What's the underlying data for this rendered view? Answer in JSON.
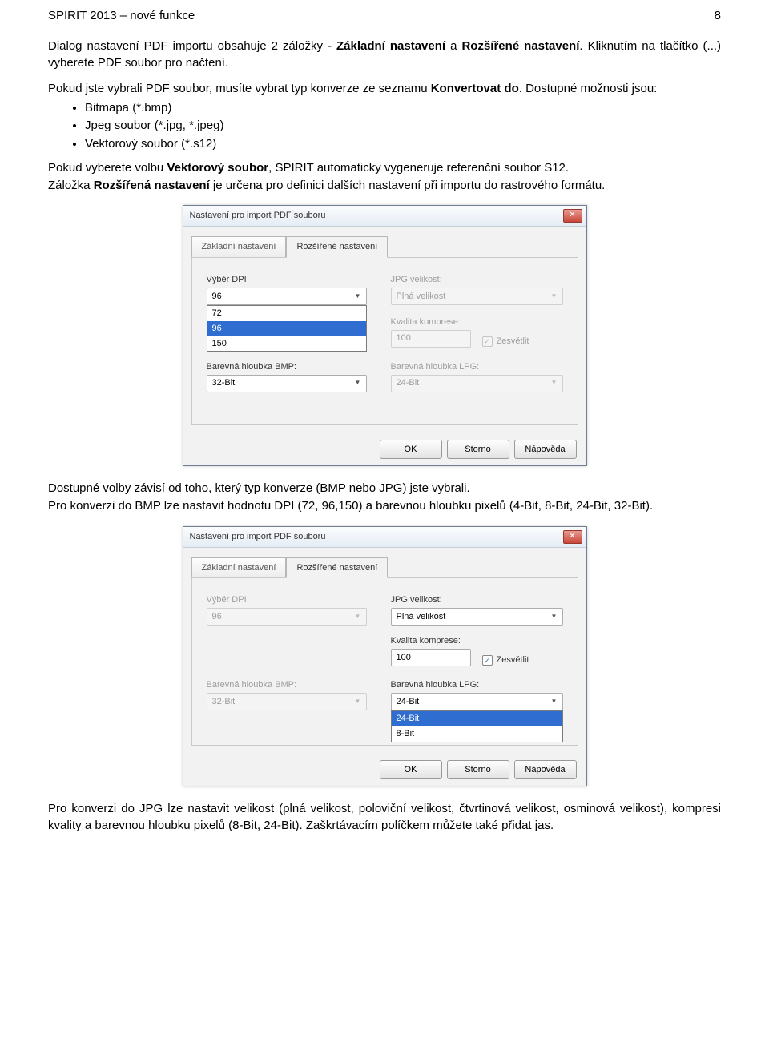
{
  "header": {
    "left": "SPIRIT 2013 – nové funkce",
    "right": "8"
  },
  "p1_a": "Dialog nastavení PDF importu obsahuje 2 záložky - ",
  "p1_b": "Základní nastavení",
  "p1_c": " a ",
  "p1_d": "Rozšířené nastavení",
  "p1_e": ". Kliknutím na tlačítko (...) vyberete PDF soubor pro načtení.",
  "p2_a": "Pokud jste vybrali PDF soubor, musíte vybrat typ konverze ze seznamu ",
  "p2_b": "Konvertovat do",
  "p2_c": ". Dostupné možnosti jsou:",
  "bullets1": [
    "Bitmapa (*.bmp)",
    "Jpeg soubor (*.jpg, *.jpeg)",
    "Vektorový soubor (*.s12)"
  ],
  "p3_a": "Pokud vyberete volbu ",
  "p3_b": "Vektorový soubor",
  "p3_c": ", SPIRIT automaticky vygeneruje referenční soubor S12.",
  "p4_a": "Záložka ",
  "p4_b": "Rozšířená nastavení",
  "p4_c": " je určena pro definici dalších nastavení při importu do rastrového formátu.",
  "p5": "Dostupné volby závisí od toho, který typ konverze (BMP nebo JPG) jste vybrali.",
  "p6": "Pro konverzi do BMP lze nastavit hodnotu DPI (72, 96,150) a barevnou hloubku pixelů (4-Bit, 8-Bit, 24-Bit, 32-Bit).",
  "p7": "Pro konverzi do JPG lze nastavit velikost (plná velikost, poloviční velikost, čtvrtinová velikost, osminová velikost), kompresi kvality a barevnou hloubku pixelů (8-Bit, 24-Bit). Zaškrtávacím políčkem můžete také přidat jas.",
  "dialog": {
    "title": "Nastavení pro import PDF souboru",
    "close": "✕",
    "tab1": "Základní nastavení",
    "tab2": "Rozšířené nastavení",
    "labels": {
      "dpi": "Výběr DPI",
      "jpgvel": "JPG velikost:",
      "kvalita": "Kvalita komprese:",
      "bmpdepth": "Barevná hloubka BMP:",
      "lpgdepth": "Barevná hloubka LPG:"
    },
    "checkbox": "Zesvětlit",
    "buttons": {
      "ok": "OK",
      "cancel": "Storno",
      "help": "Nápověda"
    }
  },
  "dlg1": {
    "dpi_value": "96",
    "dpi_options": [
      "72",
      "96",
      "150"
    ],
    "jpgvel": "Plná velikost",
    "kvalita": "100",
    "bmpdepth": "32-Bit",
    "lpgdepth": "24-Bit",
    "check_mark": "✓"
  },
  "dlg2": {
    "dpi_value": "96",
    "jpgvel": "Plná velikost",
    "kvalita": "100",
    "bmpdepth": "32-Bit",
    "lpgdepth": "24-Bit",
    "lpg_options": [
      "24-Bit",
      "8-Bit"
    ],
    "check_mark": "✓"
  }
}
